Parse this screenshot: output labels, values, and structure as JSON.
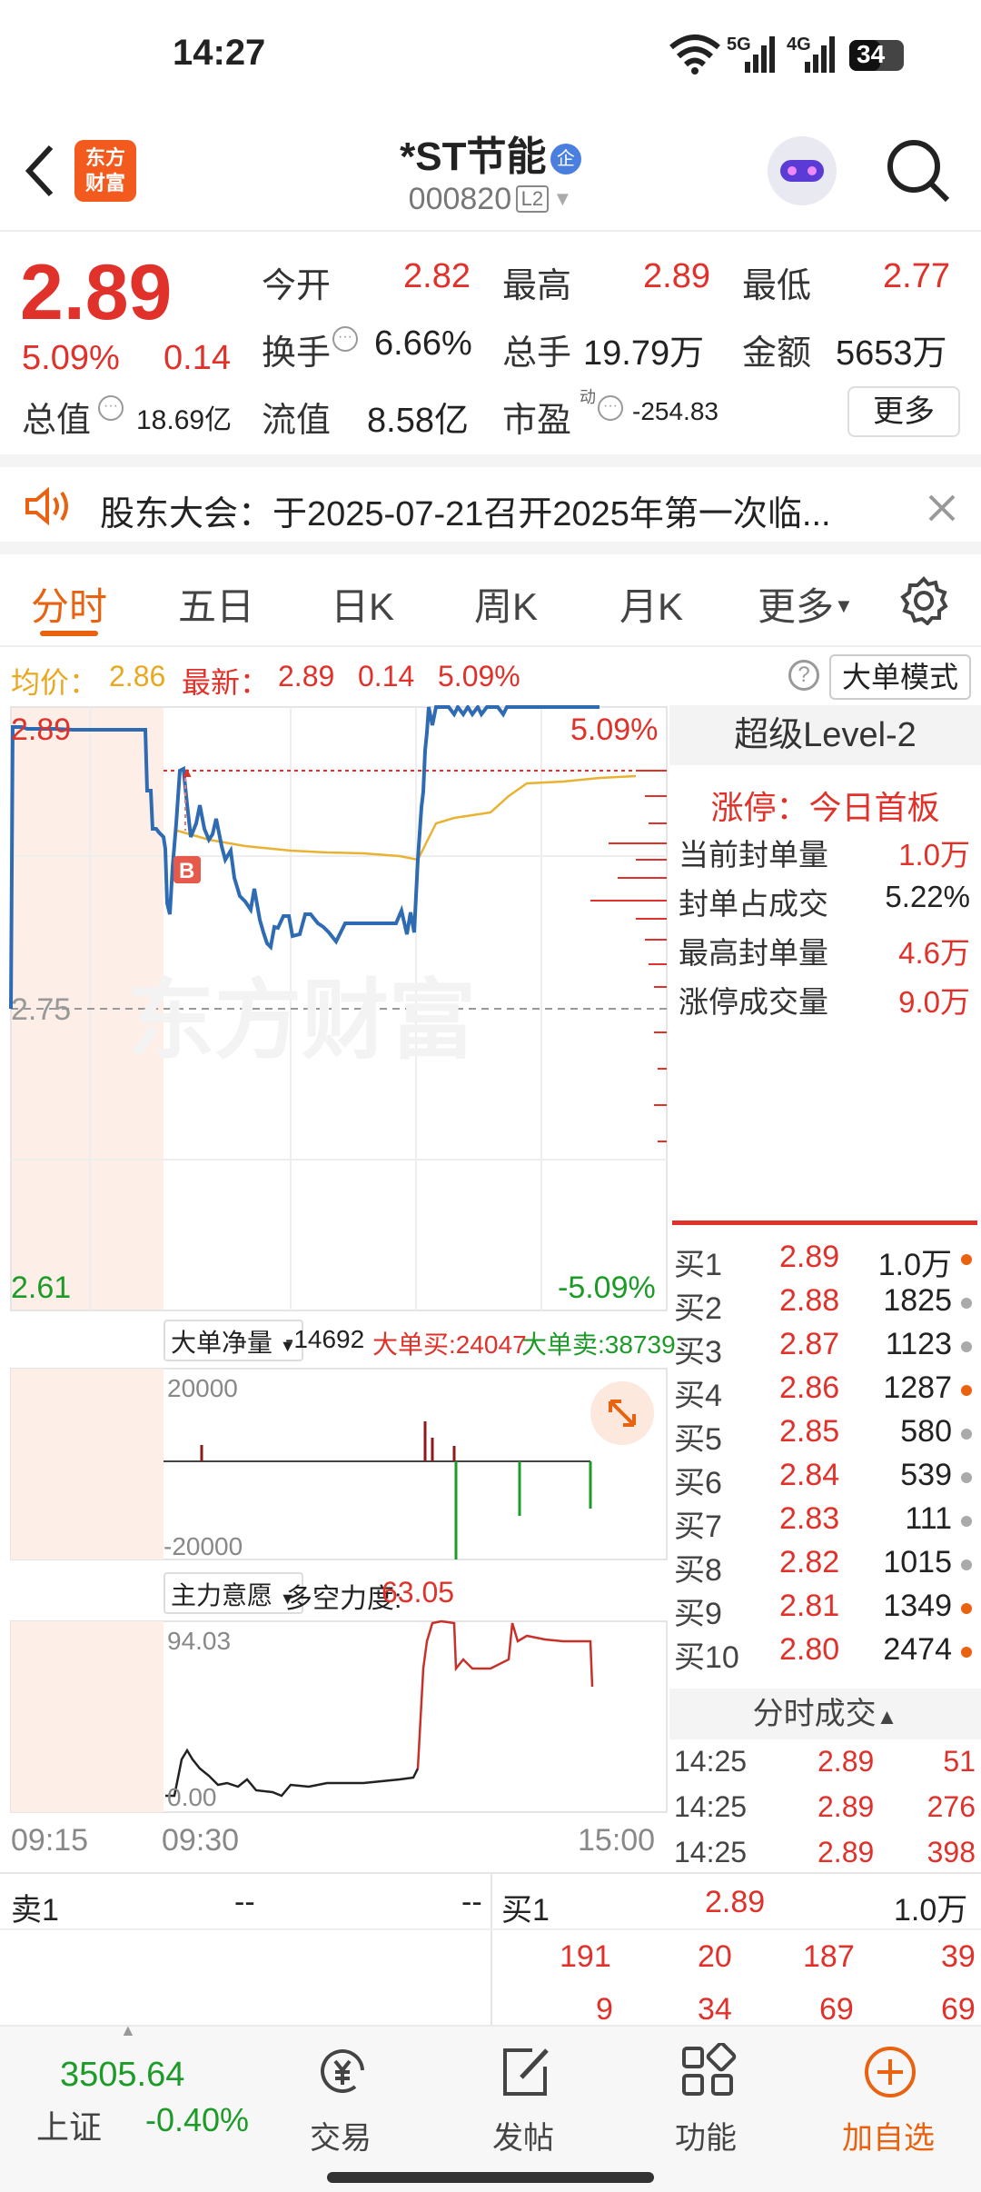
{
  "status": {
    "time": "14:27",
    "network1": "5G",
    "network2": "4G",
    "battery": "34"
  },
  "header": {
    "title": "*ST节能",
    "code": "000820",
    "l2": "L2",
    "logo_line1": "东方",
    "logo_line2": "财富",
    "badge": "企"
  },
  "quote": {
    "price": "2.89",
    "change_pct": "5.09%",
    "change": "0.14",
    "open_label": "今开",
    "open": "2.82",
    "high_label": "最高",
    "high": "2.89",
    "low_label": "最低",
    "low": "2.77",
    "turnover_label": "换手",
    "turnover": "6.66%",
    "volume_label": "总手",
    "volume": "19.79万",
    "amount_label": "金额",
    "amount": "5653万",
    "mcap_label": "总值",
    "mcap": "18.69亿",
    "float_label": "流值",
    "float": "8.58亿",
    "pe_label": "市盈",
    "pe_sup": "动",
    "pe": "-254.83",
    "more": "更多"
  },
  "notice": {
    "text": "股东大会：于2025-07-21召开2025年第一次临..."
  },
  "tabs": [
    "分时",
    "五日",
    "日K",
    "周K",
    "月K",
    "更多"
  ],
  "chart_info": {
    "avg_label": "均价：",
    "avg": "2.86",
    "latest_label": "最新：",
    "latest": "2.89",
    "chg": "0.14",
    "pct": "5.09%",
    "mode": "大单模式"
  },
  "price_axis": {
    "top": "2.89",
    "top_pct": "5.09%",
    "mid": "2.75",
    "bottom": "2.61",
    "bottom_pct": "-5.09%"
  },
  "bigorder": {
    "select": "大单净量",
    "net": "-14692",
    "buy": "大单买:24047",
    "sell": "大单卖:38739",
    "ymax": "20000",
    "ymin": "-20000"
  },
  "intent": {
    "select": "主力意愿",
    "label": "多空力度:",
    "value": "63.05",
    "ymax": "94.03",
    "ymin": "0.00"
  },
  "time_axis": [
    "09:15",
    "09:30",
    "15:00"
  ],
  "level2": {
    "title": "超级Level-2",
    "limit_title": "涨停：今日首板",
    "rows": [
      {
        "label": "当前封单量",
        "value": "1.0万"
      },
      {
        "label": "封单占成交",
        "value": "5.22%"
      },
      {
        "label": "最高封单量",
        "value": "4.6万"
      },
      {
        "label": "涨停成交量",
        "value": "9.0万"
      }
    ]
  },
  "orderbook": [
    {
      "label": "买1",
      "price": "2.89",
      "vol": "1.0万",
      "dot": "#e8620f"
    },
    {
      "label": "买2",
      "price": "2.88",
      "vol": "1825",
      "dot": "#aaaaaa"
    },
    {
      "label": "买3",
      "price": "2.87",
      "vol": "1123",
      "dot": "#aaaaaa"
    },
    {
      "label": "买4",
      "price": "2.86",
      "vol": "1287",
      "dot": "#e8620f"
    },
    {
      "label": "买5",
      "price": "2.85",
      "vol": "580",
      "dot": "#aaaaaa"
    },
    {
      "label": "买6",
      "price": "2.84",
      "vol": "539",
      "dot": "#aaaaaa"
    },
    {
      "label": "买7",
      "price": "2.83",
      "vol": "111",
      "dot": "#aaaaaa"
    },
    {
      "label": "买8",
      "price": "2.82",
      "vol": "1015",
      "dot": "#aaaaaa"
    },
    {
      "label": "买9",
      "price": "2.81",
      "vol": "1349",
      "dot": "#e8620f"
    },
    {
      "label": "买10",
      "price": "2.80",
      "vol": "2474",
      "dot": "#e8620f"
    }
  ],
  "trades_title": "分时成交",
  "trades": [
    {
      "time": "14:25",
      "price": "2.89",
      "vol": "51"
    },
    {
      "time": "14:25",
      "price": "2.89",
      "vol": "276"
    },
    {
      "time": "14:25",
      "price": "2.89",
      "vol": "398"
    }
  ],
  "bottom_book": {
    "sell1_label": "卖1",
    "sell1_price": "--",
    "sell1_vol": "--",
    "buy1_label": "买1",
    "buy1_price": "2.89",
    "buy1_vol": "1.0万",
    "row1": [
      "191",
      "20",
      "187",
      "39"
    ],
    "row2": [
      "9",
      "34",
      "69",
      "69"
    ]
  },
  "bottom_nav": {
    "index_value": "3505.64",
    "index_name": "上证",
    "index_pct": "-0.40%",
    "items": [
      "交易",
      "发帖",
      "功能",
      "加自选"
    ]
  },
  "colors": {
    "up": "#e0312a",
    "down": "#1c9b28",
    "accent": "#e8620f",
    "price_line": "#2f6bb3",
    "avg_line": "#e9b233"
  }
}
